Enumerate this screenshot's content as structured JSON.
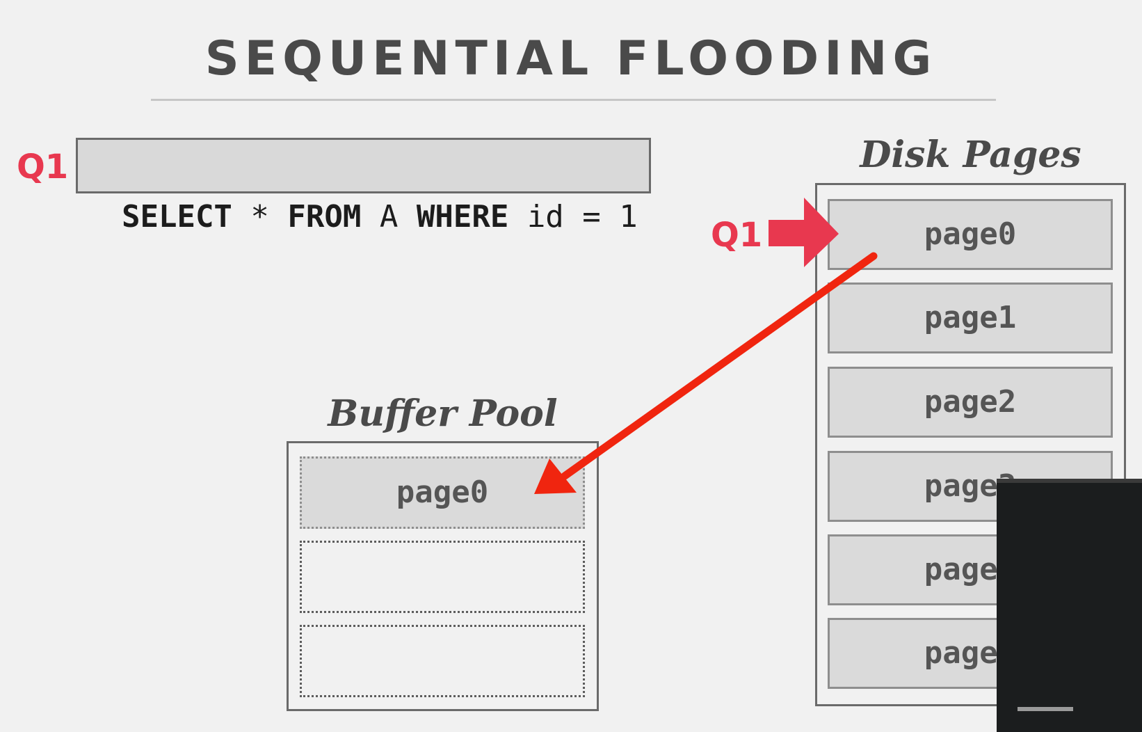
{
  "slide": {
    "title": "SEQUENTIAL FLOODING"
  },
  "query": {
    "label": "Q1",
    "tokens": [
      {
        "text": "SELECT",
        "bold": true
      },
      {
        "text": " * ",
        "bold": false
      },
      {
        "text": "FROM",
        "bold": true
      },
      {
        "text": " A ",
        "bold": false
      },
      {
        "text": "WHERE",
        "bold": true
      },
      {
        "text": " id = 1",
        "bold": false
      }
    ]
  },
  "disk": {
    "title": "Disk Pages",
    "pointer_label": "Q1",
    "pages": [
      "page0",
      "page1",
      "page2",
      "page3",
      "page4",
      "page5"
    ]
  },
  "buffer_pool": {
    "title": "Buffer Pool",
    "slots": [
      "page0",
      "",
      ""
    ]
  },
  "colors": {
    "accent": "#e8384f",
    "annotation_arrow": "#f0250f",
    "text": "#4a4a4a",
    "page_fill": "#dadada",
    "background": "#f1f1f1"
  }
}
